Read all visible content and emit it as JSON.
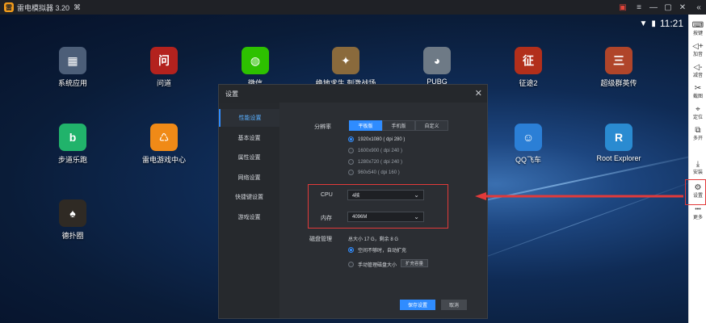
{
  "titlebar": {
    "app_title": "雷电模拟器 3.20",
    "logo_glyph": "雷",
    "gift_icon": "gift-icon",
    "menu_icon": "menu-icon"
  },
  "statusbar": {
    "time": "11:21"
  },
  "apps": [
    {
      "label": "系统应用",
      "icon": "system-apps-icon",
      "glyph": "▦",
      "color": "#4c5e78"
    },
    {
      "label": "问道",
      "icon": "wendao-icon",
      "glyph": "问",
      "color": "#b3221e"
    },
    {
      "label": "微信",
      "icon": "wechat-icon",
      "glyph": "◍",
      "color": "#2dc100"
    },
    {
      "label": "绝地求生 刺激战场",
      "icon": "pubg-mobile-icon",
      "glyph": "✦",
      "color": "#8a6a3c"
    },
    {
      "label": "PUBG",
      "icon": "android-icon",
      "glyph": "◕",
      "color": "#6e7a86"
    },
    {
      "label": "征途2",
      "icon": "zhengtu2-icon",
      "glyph": "征",
      "color": "#b22f1b"
    },
    {
      "label": "超级群英传",
      "icon": "chaojiqunying-icon",
      "glyph": "三",
      "color": "#b0452a"
    },
    {
      "label": "步道乐跑",
      "icon": "budao-icon",
      "glyph": "b",
      "color": "#21b36b"
    },
    {
      "label": "雷电游戏中心",
      "icon": "leidian-center-icon",
      "glyph": "♺",
      "color": "#f08a17"
    },
    {
      "label": "QQ飞车",
      "icon": "qq-speed-icon",
      "glyph": "☺",
      "color": "#2b7fd6"
    },
    {
      "label": "Root Explorer",
      "icon": "root-explorer-icon",
      "glyph": "R",
      "color": "#2a8bd1"
    },
    {
      "label": "德扑圈",
      "icon": "poker-icon",
      "glyph": "♠",
      "color": "#2f2a24"
    }
  ],
  "sidebar": {
    "items": [
      {
        "label": "按键",
        "icon": "keyboard-icon",
        "glyph": "⌨"
      },
      {
        "label": "加音",
        "icon": "volume-up-icon",
        "glyph": "🔊"
      },
      {
        "label": "减音",
        "icon": "volume-down-icon",
        "glyph": "🔉"
      },
      {
        "label": "截图",
        "icon": "screenshot-icon",
        "glyph": "✂"
      },
      {
        "label": "定位",
        "icon": "location-icon",
        "glyph": "⌖"
      },
      {
        "label": "多开",
        "icon": "multi-instance-icon",
        "glyph": "⧉"
      },
      {
        "label": "安装",
        "icon": "install-icon",
        "glyph": "⤓"
      },
      {
        "label": "设置",
        "icon": "settings-gear-icon",
        "glyph": "⚙"
      },
      {
        "label": "更多",
        "icon": "more-icon",
        "glyph": "•••"
      }
    ]
  },
  "dialog": {
    "title": "设置",
    "close_glyph": "✕",
    "nav": [
      "性能设置",
      "基本设置",
      "属性设置",
      "网络设置",
      "快捷键设置",
      "游戏设置"
    ],
    "resolution": {
      "label": "分辨率",
      "tabs": [
        "平板版",
        "手机版",
        "自定义"
      ],
      "selected_tab": 0,
      "options": [
        "1920x1080 ( dpi 280 )",
        "1600x900 ( dpi 240 )",
        "1280x720 ( dpi 240 )",
        "960x540 ( dpi 160 )"
      ],
      "selected_option": 0
    },
    "cpu": {
      "label": "CPU",
      "value": "4核"
    },
    "memory": {
      "label": "内存",
      "value": "4096M"
    },
    "disk": {
      "label": "磁盘管理",
      "summary": "总大小 17 G，剩余 8 G",
      "auto_expand": "空间不够时，自动扩充",
      "manual": "手动管理磁盘大小",
      "expand_button": "扩充容量"
    },
    "save_button": "保存设置",
    "cancel_button": "取消"
  },
  "colors": {
    "accent": "#2f8cff",
    "highlight": "#e23a3a"
  }
}
